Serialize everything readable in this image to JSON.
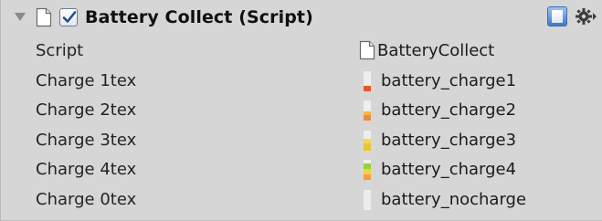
{
  "component": {
    "title": "Battery Collect (Script)",
    "enabled": true,
    "fold_icon": "triangle-down-icon",
    "script_icon": "document-icon",
    "help_icon": "help-book-icon",
    "settings_icon": "gear-icon"
  },
  "fields": [
    {
      "label": "Script",
      "value": "BatteryCollect",
      "icon": "document-icon"
    },
    {
      "label": "Charge 1tex",
      "value": "battery_charge1",
      "icon": "battery-texture-icon",
      "color": "#e4572e"
    },
    {
      "label": "Charge 2tex",
      "value": "battery_charge2",
      "icon": "battery-texture-icon",
      "color": "#f08a3c"
    },
    {
      "label": "Charge 3tex",
      "value": "battery_charge3",
      "icon": "battery-texture-icon",
      "color": "#e8c53a"
    },
    {
      "label": "Charge 4tex",
      "value": "battery_charge4",
      "icon": "battery-texture-icon",
      "color": "#9bcf3f"
    },
    {
      "label": "Charge 0tex",
      "value": "battery_nocharge",
      "icon": "battery-texture-icon",
      "color": "#ececec"
    }
  ]
}
